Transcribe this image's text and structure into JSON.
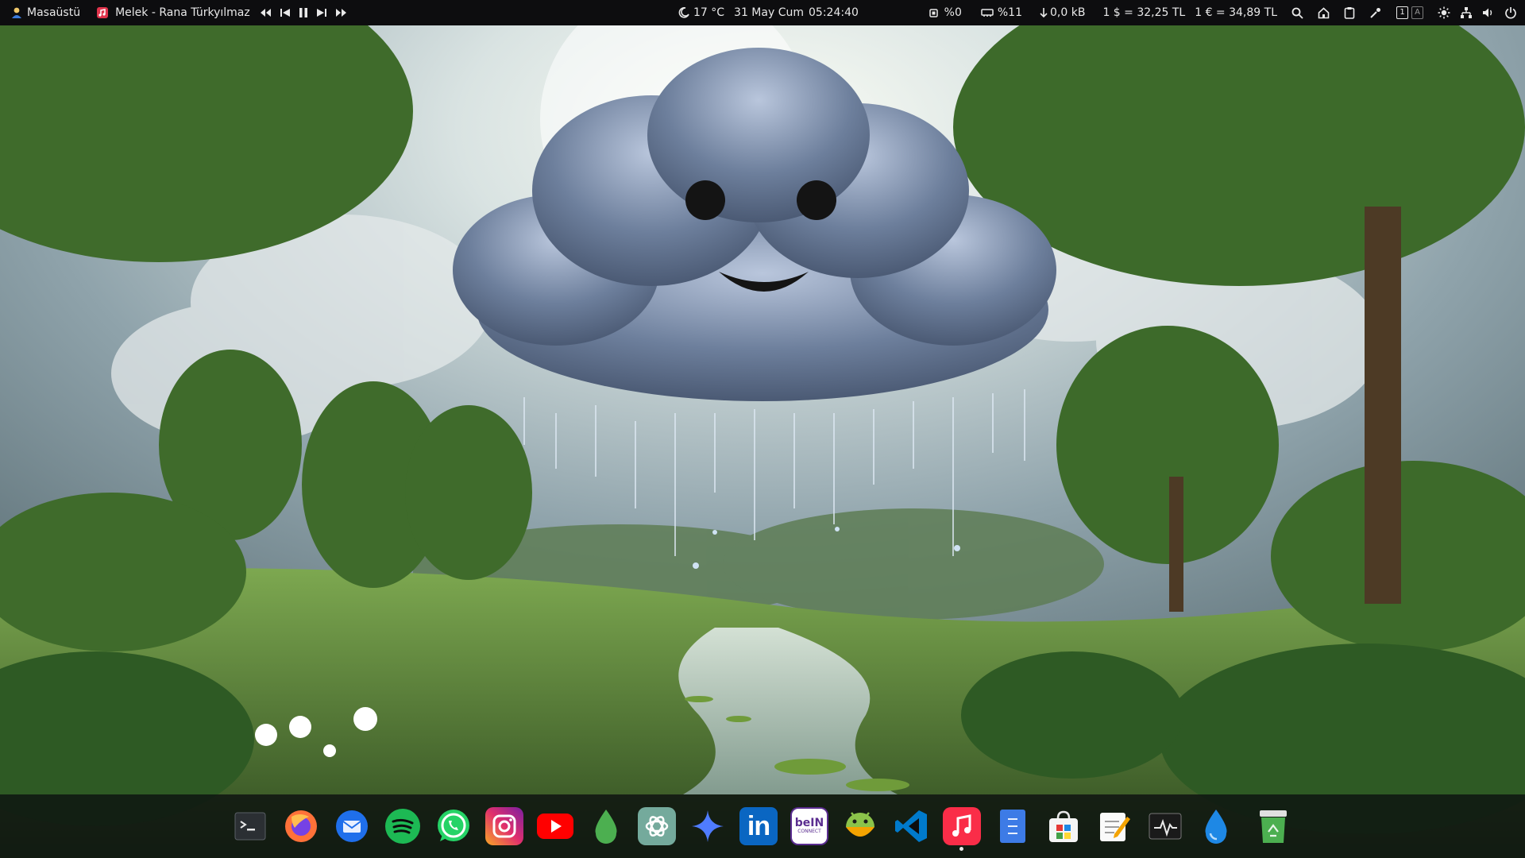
{
  "topbar": {
    "desktop_label": "Masaüstü",
    "media_title": "Melek - Rana Türkyılmaz",
    "weather": "17 °C",
    "date": "31 May Cum",
    "time": "05:24:40",
    "cpu": "%0",
    "memory": "%11",
    "download": "0,0 kB",
    "usd_rate": "1 $ = 32,25 TL",
    "eur_rate": "1 € = 34,89 TL",
    "workspace_indicator": "1",
    "keyboard_layout": "A"
  },
  "dock": {
    "apps": [
      {
        "name": "terminal",
        "icon": "terminal-icon",
        "color": "#2b2f33"
      },
      {
        "name": "firefox",
        "icon": "firefox-icon",
        "color": "#ff7139"
      },
      {
        "name": "thunderbird",
        "icon": "thunderbird-icon",
        "color": "#1f6feb"
      },
      {
        "name": "spotify",
        "icon": "spotify-icon",
        "color": "#1db954"
      },
      {
        "name": "whatsapp",
        "icon": "whatsapp-icon",
        "color": "#25d366"
      },
      {
        "name": "instagram",
        "icon": "instagram-icon",
        "color": "#e1306c"
      },
      {
        "name": "youtube",
        "icon": "youtube-icon",
        "color": "#ff0000"
      },
      {
        "name": "drop",
        "icon": "droplet-icon",
        "color": "#4caf50"
      },
      {
        "name": "chatgpt",
        "icon": "chatgpt-icon",
        "color": "#74aa9c"
      },
      {
        "name": "gemini",
        "icon": "sparkle-icon",
        "color": "#4f7cff"
      },
      {
        "name": "linkedin",
        "icon": "linkedin-icon",
        "color": "#0a66c2"
      },
      {
        "name": "bein-connect",
        "icon": "bein-connect-icon",
        "color": "#5b2d90"
      },
      {
        "name": "android-app",
        "icon": "android-icon",
        "color": "#8bc34a"
      },
      {
        "name": "vscode",
        "icon": "vscode-icon",
        "color": "#007acc"
      },
      {
        "name": "music",
        "icon": "music-icon",
        "color": "#fa2d48"
      },
      {
        "name": "files",
        "icon": "file-manager-icon",
        "color": "#3d7be6"
      },
      {
        "name": "software-center",
        "icon": "software-store-icon",
        "color": "#e8e8e8"
      },
      {
        "name": "text-editor",
        "icon": "text-editor-icon",
        "color": "#f4a300"
      },
      {
        "name": "system-monitor",
        "icon": "system-monitor-icon",
        "color": "#1a1a1a"
      },
      {
        "name": "droplet-app",
        "icon": "water-droplet-icon",
        "color": "#1e88e5"
      },
      {
        "name": "trash",
        "icon": "trash-icon",
        "color": "#4caf50"
      }
    ],
    "labels": {
      "bein_top": "beIN",
      "bein_bottom": "CONNECT",
      "linkedin": "in"
    }
  }
}
